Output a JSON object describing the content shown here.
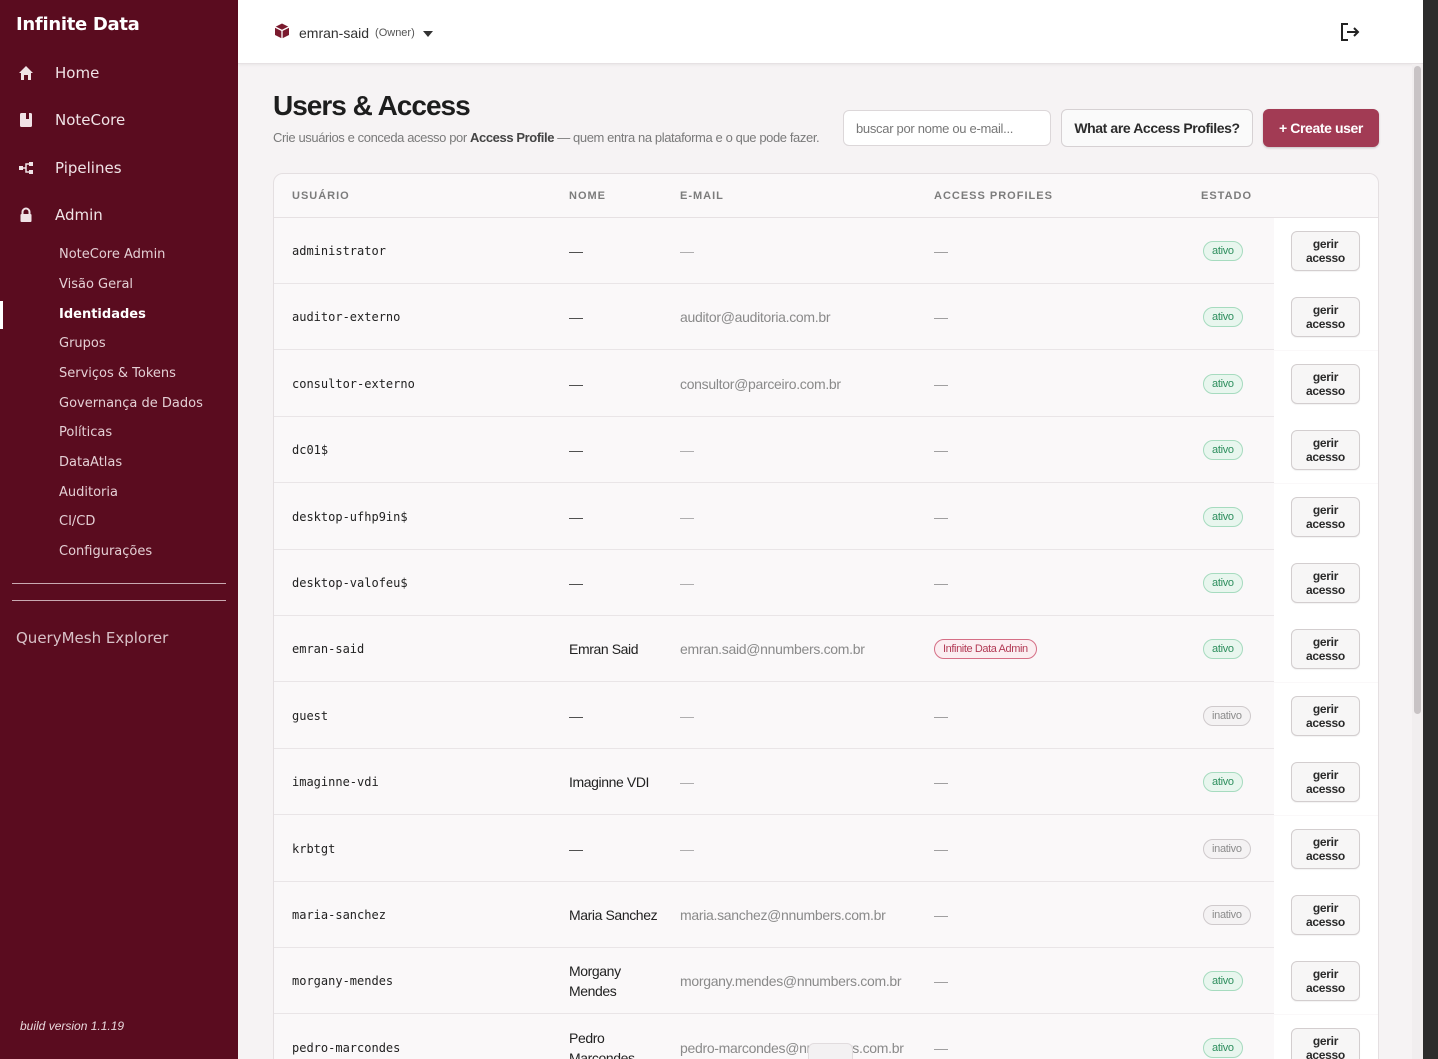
{
  "sidebar": {
    "brand": "Infinite Data",
    "nav": [
      {
        "label": "Home",
        "icon": "home-icon"
      },
      {
        "label": "NoteCore",
        "icon": "notebook-icon"
      },
      {
        "label": "Pipelines",
        "icon": "pipeline-icon"
      },
      {
        "label": "Admin",
        "icon": "lock-icon"
      }
    ],
    "admin_items": [
      {
        "label": "NoteCore Admin"
      },
      {
        "label": "Visão Geral"
      },
      {
        "label": "Identidades",
        "active": true
      },
      {
        "label": "Grupos"
      },
      {
        "label": "Serviços & Tokens"
      },
      {
        "label": "Governança de Dados"
      },
      {
        "label": "Políticas"
      },
      {
        "label": "DataAtlas"
      },
      {
        "label": "Auditoria"
      },
      {
        "label": "CI/CD"
      },
      {
        "label": "Configurações"
      }
    ],
    "querymesh": "QueryMesh Explorer",
    "build": "build version 1.1.19"
  },
  "topbar": {
    "tenant": "emran-said",
    "role": "(Owner)"
  },
  "page": {
    "title": "Users & Access",
    "subtitle_pre": "Crie usuários e conceda acesso por ",
    "subtitle_bold": "Access Profile",
    "subtitle_post": " — quem entra na plataforma e o que pode fazer.",
    "search_placeholder": "buscar por nome ou e-mail...",
    "help_button": "What are Access Profiles?",
    "create_button": "+ Create user"
  },
  "table": {
    "headers": {
      "user": "USUÁRIO",
      "name": "NOME",
      "email": "E-MAIL",
      "profiles": "ACCESS PROFILES",
      "state": "ESTADO"
    },
    "action_label": "gerir acesso",
    "rows": [
      {
        "user": "administrator",
        "name": "—",
        "email": "—",
        "profile": "—",
        "state": "ativo"
      },
      {
        "user": "auditor-externo",
        "name": "—",
        "email": "auditor@auditoria.com.br",
        "profile": "—",
        "state": "ativo"
      },
      {
        "user": "consultor-externo",
        "name": "—",
        "email": "consultor@parceiro.com.br",
        "profile": "—",
        "state": "ativo"
      },
      {
        "user": "dc01$",
        "name": "—",
        "email": "—",
        "profile": "—",
        "state": "ativo"
      },
      {
        "user": "desktop-ufhp9in$",
        "name": "—",
        "email": "—",
        "profile": "—",
        "state": "ativo"
      },
      {
        "user": "desktop-valofeu$",
        "name": "—",
        "email": "—",
        "profile": "—",
        "state": "ativo"
      },
      {
        "user": "emran-said",
        "name": "Emran Said",
        "email": "emran.said@nnumbers.com.br",
        "profile": "Infinite Data Admin",
        "state": "ativo"
      },
      {
        "user": "guest",
        "name": "—",
        "email": "—",
        "profile": "—",
        "state": "inativo"
      },
      {
        "user": "imaginne-vdi",
        "name": "Imaginne VDI",
        "email": "—",
        "profile": "—",
        "state": "ativo"
      },
      {
        "user": "krbtgt",
        "name": "—",
        "email": "—",
        "profile": "—",
        "state": "inativo"
      },
      {
        "user": "maria-sanchez",
        "name": "Maria Sanchez",
        "email": "maria.sanchez@nnumbers.com.br",
        "profile": "—",
        "state": "inativo"
      },
      {
        "user": "morgany-mendes",
        "name": "Morgany Mendes",
        "email": "morgany.mendes@nnumbers.com.br",
        "profile": "—",
        "state": "ativo"
      },
      {
        "user": "pedro-marcondes",
        "name": "Pedro Marcondes",
        "email": "pedro-marcondes@nnumbers.com.br",
        "profile": "—",
        "state": "ativo"
      }
    ]
  },
  "colors": {
    "sidebar": "#5a0c1f",
    "accent": "#a23b54",
    "active_green": "#2e8f5e"
  }
}
